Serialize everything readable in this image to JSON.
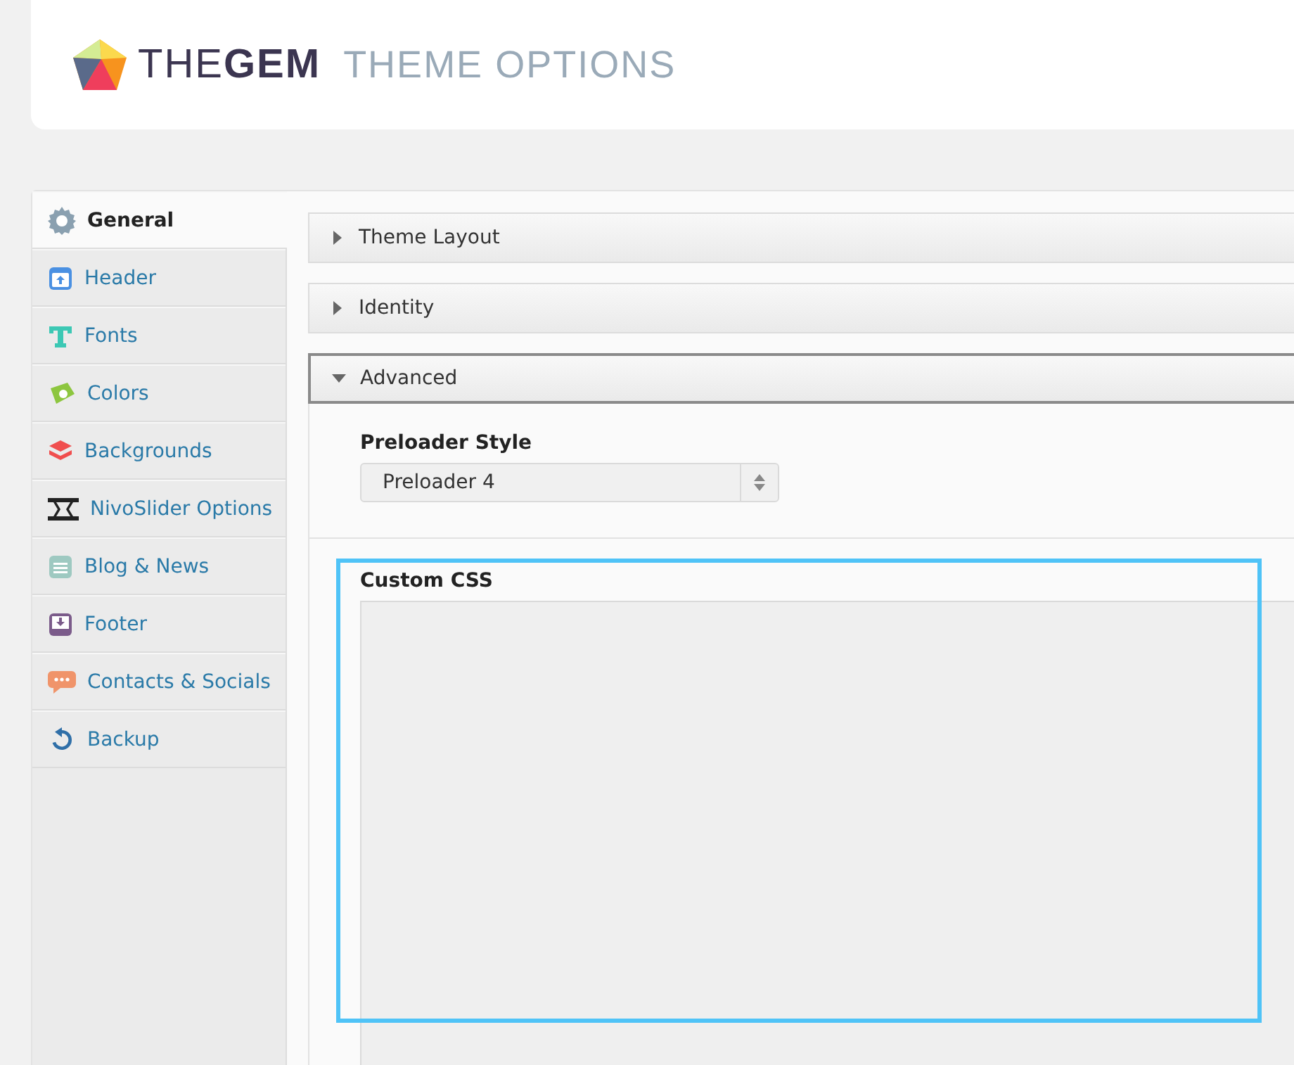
{
  "logo": {
    "brand": "THE**GEM**",
    "subtitle": "THEME OPTIONS"
  },
  "sidebar": {
    "items": [
      {
        "label": "General",
        "selected": true
      },
      {
        "label": "Header",
        "selected": false
      },
      {
        "label": "Fonts",
        "selected": false
      },
      {
        "label": "Colors",
        "selected": false
      },
      {
        "label": "Backgrounds",
        "selected": false
      },
      {
        "label": "NivoSlider Options",
        "selected": false
      },
      {
        "label": "Blog & News",
        "selected": false
      },
      {
        "label": "Footer",
        "selected": false
      },
      {
        "label": "Contacts & Socials",
        "selected": false
      },
      {
        "label": "Backup",
        "selected": false
      }
    ]
  },
  "sections": [
    {
      "title": "Theme Layout",
      "expanded": false
    },
    {
      "title": "Identity",
      "expanded": false
    },
    {
      "title": "Advanced",
      "expanded": true
    }
  ],
  "advanced": {
    "preloader_style": {
      "label": "Preloader Style",
      "value": "Preloader 4"
    },
    "custom_css": {
      "label": "Custom CSS",
      "highlighted": true
    }
  }
}
